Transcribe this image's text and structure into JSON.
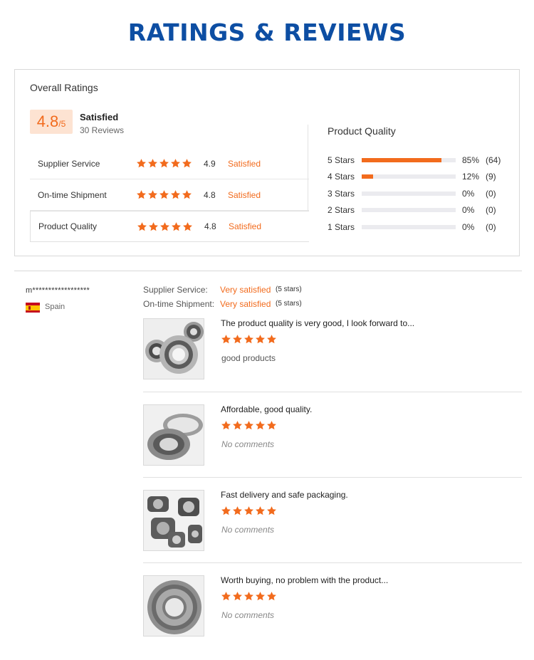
{
  "page": {
    "title": "RATINGS & REVIEWS"
  },
  "overall": {
    "heading": "Overall Ratings",
    "score": "4.8",
    "score_denominator": "/5",
    "status": "Satisfied",
    "review_count": "30 Reviews",
    "metrics": [
      {
        "name": "Supplier Service",
        "stars": 5,
        "score": "4.9",
        "status": "Satisfied"
      },
      {
        "name": "On-time Shipment",
        "stars": 5,
        "score": "4.8",
        "status": "Satisfied"
      },
      {
        "name": "Product Quality",
        "stars": 5,
        "score": "4.8",
        "status": "Satisfied"
      }
    ]
  },
  "product_quality": {
    "heading": "Product Quality",
    "distribution": [
      {
        "label": "5  Stars",
        "fraction": 0.85,
        "pct": "85%",
        "count": "(64)"
      },
      {
        "label": "4  Stars",
        "fraction": 0.12,
        "pct": "12%",
        "count": "(9)"
      },
      {
        "label": "3  Stars",
        "fraction": 0,
        "pct": "0%",
        "count": "(0)"
      },
      {
        "label": "2  Stars",
        "fraction": 0,
        "pct": "0%",
        "count": "(0)"
      },
      {
        "label": "1  Stars",
        "fraction": 0,
        "pct": "0%",
        "count": "(0)"
      }
    ]
  },
  "reviewer": {
    "name": "m******************",
    "country": "Spain",
    "flag_icon": "spain-flag-icon",
    "supplier_service_label": "Supplier Service:",
    "supplier_service_value": "Very satisfied",
    "supplier_service_stars": "(5 stars)",
    "shipment_label": "On-time Shipment:",
    "shipment_value": "Very satisfied",
    "shipment_stars": "(5 stars)"
  },
  "reviews": [
    {
      "text": "The product quality is very good, I look forward to...",
      "stars": 5,
      "comment": "good products",
      "muted": false,
      "image": "ball-bearings-photo"
    },
    {
      "text": "Affordable, good quality.",
      "stars": 5,
      "comment": "No comments",
      "muted": true,
      "image": "tapered-roller-bearing-photo"
    },
    {
      "text": "Fast delivery and safe packaging.",
      "stars": 5,
      "comment": "No comments",
      "muted": true,
      "image": "flange-bearing-units-photo"
    },
    {
      "text": "Worth buying, no problem with the product...",
      "stars": 5,
      "comment": "No comments",
      "muted": true,
      "image": "spherical-roller-bearing-photo"
    }
  ],
  "colors": {
    "accent": "#f26b1d",
    "title": "#0d4ea3",
    "badge_bg": "#fde3d2"
  }
}
